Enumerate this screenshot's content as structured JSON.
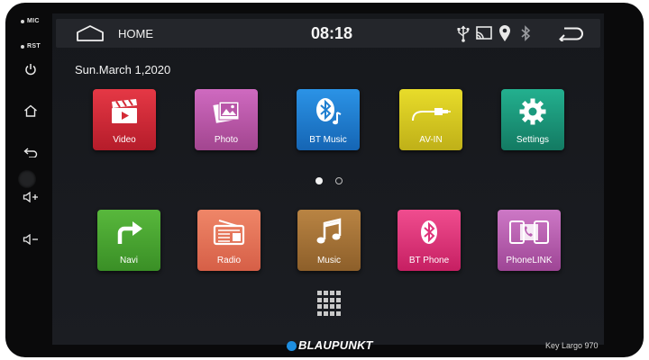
{
  "bezel": {
    "mic_label": "MIC",
    "rst_label": "RST",
    "buttons": [
      "power-icon",
      "home-outline-icon",
      "back-icon",
      "volume-up-icon",
      "volume-down-icon"
    ]
  },
  "statusbar": {
    "home_label": "HOME",
    "time": "08:18",
    "icons": [
      "usb-icon",
      "screen-cast-icon",
      "location-pin-icon",
      "bluetooth-icon",
      "return-icon"
    ]
  },
  "date": "Sun.March 1,2020",
  "apps_row1": [
    {
      "label": "Video",
      "icon": "video-clapper-icon",
      "color": "#d42a35"
    },
    {
      "label": "Photo",
      "icon": "photo-icon",
      "color": "#b856a8"
    },
    {
      "label": "BT Music",
      "icon": "bluetooth-music-icon",
      "color": "#1f7fd0"
    },
    {
      "label": "AV-IN",
      "icon": "av-cable-icon",
      "color": "#d9cc22"
    },
    {
      "label": "Settings",
      "icon": "gear-icon",
      "color": "#1b9a7e"
    }
  ],
  "apps_row2": [
    {
      "label": "Navi",
      "icon": "turn-right-arrow-icon",
      "color": "#4aa532"
    },
    {
      "label": "Radio",
      "icon": "radio-icon",
      "color": "#e4735a"
    },
    {
      "label": "Music",
      "icon": "music-note-icon",
      "color": "#a57235"
    },
    {
      "label": "BT Phone",
      "icon": "bluetooth-phone-icon",
      "color": "#e0337a"
    },
    {
      "label": "PhoneLINK",
      "icon": "phone-link-icon",
      "color": "#b85cb0"
    }
  ],
  "pager": {
    "pages": 2,
    "current": 1
  },
  "app_drawer_icon": "app-grid-icon",
  "brand": "BLAUPUNKT",
  "model": "Key Largo 970"
}
